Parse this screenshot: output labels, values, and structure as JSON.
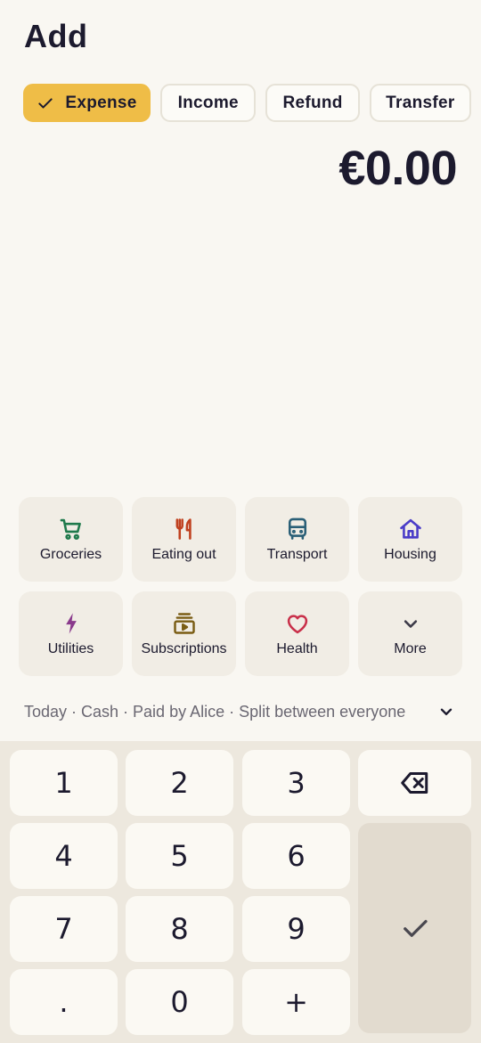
{
  "header": {
    "title": "Add"
  },
  "types": [
    {
      "label": "Expense",
      "active": true
    },
    {
      "label": "Income",
      "active": false
    },
    {
      "label": "Refund",
      "active": false
    },
    {
      "label": "Transfer",
      "active": false
    }
  ],
  "amount": "€0.00",
  "categories": [
    {
      "label": "Groceries",
      "icon": "cart-icon",
      "color": "#1f7a4c"
    },
    {
      "label": "Eating out",
      "icon": "fork-knife-icon",
      "color": "#c0411f"
    },
    {
      "label": "Transport",
      "icon": "bus-icon",
      "color": "#2a5f77"
    },
    {
      "label": "Housing",
      "icon": "house-icon",
      "color": "#4a3cc8"
    },
    {
      "label": "Utilities",
      "icon": "lightning-icon",
      "color": "#8a3a8c"
    },
    {
      "label": "Subscriptions",
      "icon": "subscriptions-icon",
      "color": "#7a5d14"
    },
    {
      "label": "Health",
      "icon": "heart-icon",
      "color": "#c9304a"
    },
    {
      "label": "More",
      "icon": "chevron-down-icon",
      "color": "#3c3a48"
    }
  ],
  "meta": {
    "summary": "Today · Cash · Paid by Alice · Split between everyone"
  },
  "keypad": {
    "k1": "1",
    "k2": "2",
    "k3": "3",
    "k4": "4",
    "k5": "5",
    "k6": "6",
    "k7": "7",
    "k8": "8",
    "k9": "9",
    "kdot": ".",
    "k0": "0",
    "kplus": "+",
    "backspace_icon": "backspace-icon",
    "submit_icon": "check-icon"
  },
  "colors": {
    "accent": "#efbd47",
    "background": "#f9f7f2",
    "text": "#1c1a2e"
  }
}
